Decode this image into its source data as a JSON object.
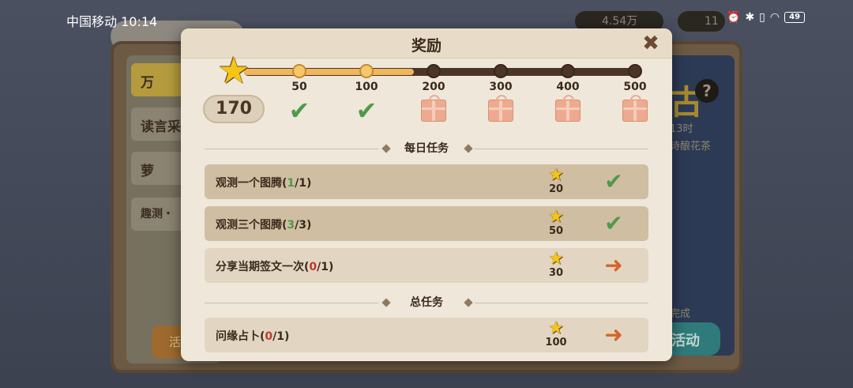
{
  "status_bar": {
    "carrier": "中国移动",
    "time": "10:14",
    "battery": "49"
  },
  "background": {
    "resource_1": "4.54万",
    "resource_2": "11",
    "tabs": [
      "万",
      "读言采",
      "萝",
      "趣测・"
    ],
    "right_big": "古",
    "right_help": "?",
    "right_text_1": "13时",
    "right_text_2": "诗酿花茶",
    "right_text_3": "完成",
    "activity_button": "活动",
    "left_button": "活"
  },
  "modal": {
    "title": "奖励",
    "close_icon": "close-icon",
    "score": "170",
    "progress_value": 170,
    "milestones": [
      {
        "label": "50",
        "state": "claimed"
      },
      {
        "label": "100",
        "state": "claimed"
      },
      {
        "label": "200",
        "state": "locked"
      },
      {
        "label": "300",
        "state": "locked"
      },
      {
        "label": "400",
        "state": "locked"
      },
      {
        "label": "500",
        "state": "locked"
      }
    ],
    "daily_section_title": "每日任务",
    "total_section_title": "总任务",
    "daily_tasks": [
      {
        "name": "观测一个图腾(",
        "progress": "1",
        "total": "/1)",
        "points": "20",
        "status": "done"
      },
      {
        "name": "观测三个图腾(",
        "progress": "3",
        "total": "/3)",
        "points": "50",
        "status": "done"
      },
      {
        "name": "分享当期签文一次(",
        "progress": "0",
        "total": "/1)",
        "points": "30",
        "status": "go"
      }
    ],
    "total_tasks": [
      {
        "name": "问缘占卜(",
        "progress": "0",
        "total": "/1)",
        "points": "100",
        "status": "go"
      }
    ]
  }
}
